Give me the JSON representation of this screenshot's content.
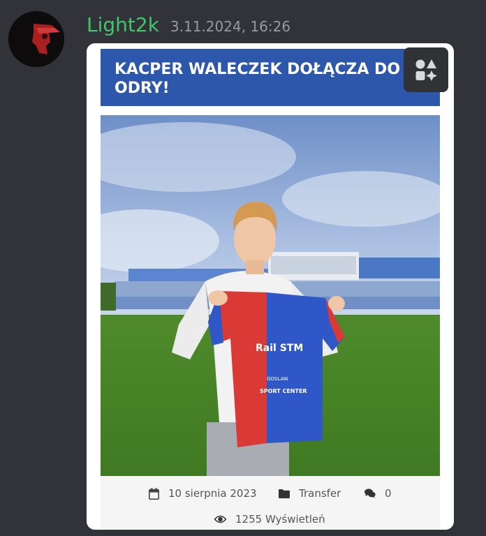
{
  "message": {
    "username": "Light2k",
    "timestamp": "3.11.2024, 16:26"
  },
  "colors": {
    "background": "#313338",
    "username": "#43c56c",
    "timestamp": "#949ba4",
    "banner": "#2c57ab"
  },
  "embed": {
    "title_line1": "KACPER WALECZEK DOŁĄCZA DO",
    "title_line2": "ODRY!",
    "meta": {
      "date": "10 sierpnia 2023",
      "date_icon": "calendar-icon",
      "category": "Transfer",
      "category_icon": "folder-icon",
      "comments": "0",
      "comments_icon": "comments-icon",
      "views": "1255 Wyświetleń",
      "views_icon": "eye-icon"
    },
    "jersey": {
      "sponsor": "Rail STM",
      "sponsor2": "SPORT CENTER",
      "city": "GOSLAW"
    }
  },
  "media_button_icon": "app-launcher-icon"
}
